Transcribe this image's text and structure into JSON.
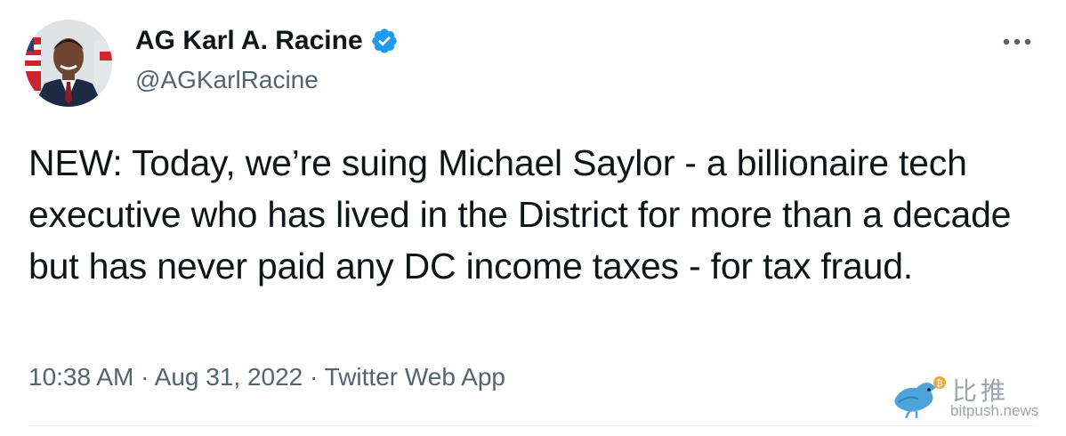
{
  "author": {
    "display_name": "AG Karl A. Racine",
    "handle": "@AGKarlRacine",
    "verified": true,
    "avatar_icon": "profile-photo"
  },
  "tweet": {
    "text": "NEW: Today, we’re suing Michael Saylor - a billionaire tech executive who has lived in the District for more than a decade but has never paid any DC income taxes - for tax fraud.",
    "time": "10:38 AM",
    "separator": "·",
    "date": "Aug 31, 2022",
    "source": "Twitter Web App"
  },
  "more_menu": {
    "icon": "more-horizontal-icon"
  },
  "watermark": {
    "chinese": "比推",
    "url": "bitpush.news"
  },
  "colors": {
    "text_primary": "#0f1419",
    "text_secondary": "#536471",
    "verified_blue": "#1d9bf0",
    "watermark_gray": "#9aa5ae"
  }
}
